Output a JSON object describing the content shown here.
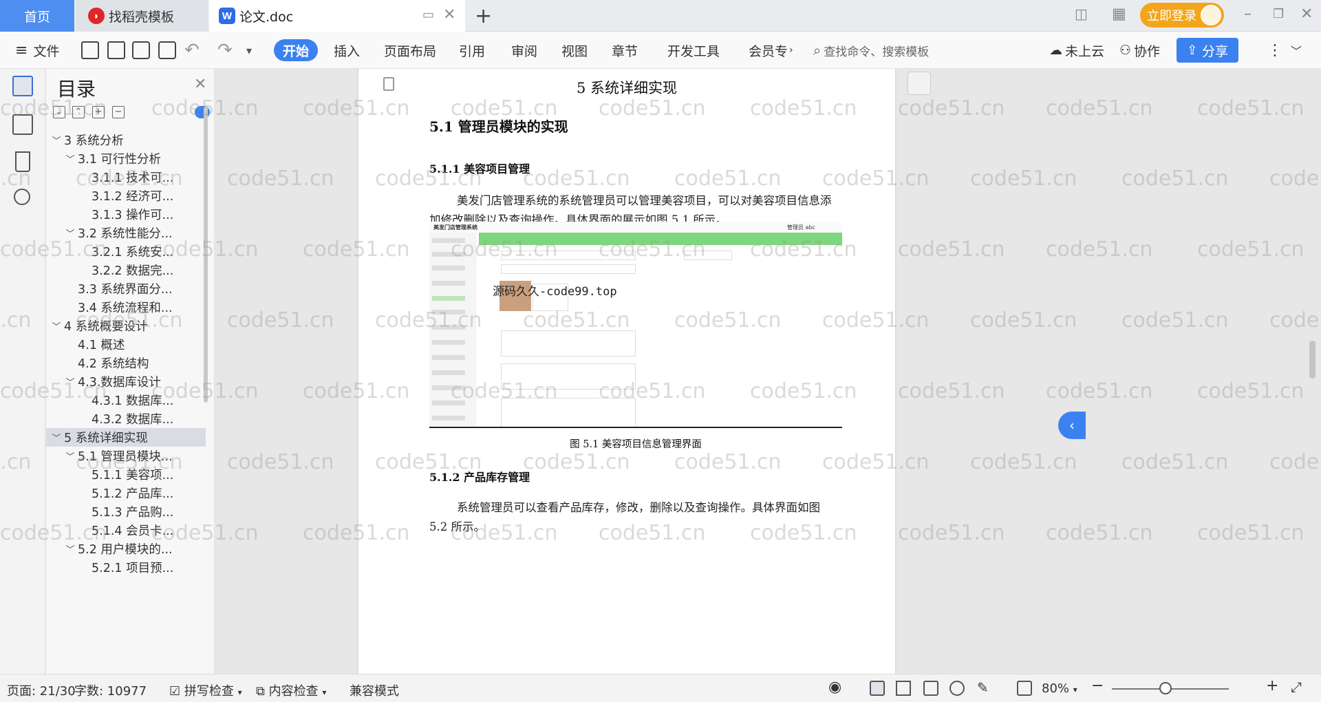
{
  "tabs": {
    "home": "首页",
    "template": "找稻壳模板",
    "doc": "论文.doc"
  },
  "topright": {
    "login": "立即登录"
  },
  "toolbar": {
    "file": "文件",
    "menus": [
      "开始",
      "插入",
      "页面布局",
      "引用",
      "审阅",
      "视图",
      "章节",
      "开发工具",
      "会员专"
    ],
    "search_placeholder": "查找命令、搜索模板",
    "cloud": "未上云",
    "collab": "协作",
    "share": "分享"
  },
  "toc": {
    "title": "目录",
    "items": [
      {
        "level": 1,
        "caret": "﹀",
        "label": "3 系统分析",
        "active": false
      },
      {
        "level": 2,
        "caret": "﹀",
        "label": "3.1 可行性分析",
        "active": false
      },
      {
        "level": 3,
        "caret": "",
        "label": "3.1.1 技术可...",
        "active": false
      },
      {
        "level": 3,
        "caret": "",
        "label": "3.1.2 经济可...",
        "active": false
      },
      {
        "level": 3,
        "caret": "",
        "label": "3.1.3 操作可...",
        "active": false
      },
      {
        "level": 2,
        "caret": "﹀",
        "label": "3.2 系统性能分...",
        "active": false
      },
      {
        "level": 3,
        "caret": "",
        "label": "3.2.1  系统安...",
        "active": false
      },
      {
        "level": 3,
        "caret": "",
        "label": "3.2.2  数据完...",
        "active": false
      },
      {
        "level": 2,
        "caret": "",
        "label": "3.3 系统界面分...",
        "active": false
      },
      {
        "level": 2,
        "caret": "",
        "label": "3.4 系统流程和...",
        "active": false
      },
      {
        "level": 1,
        "caret": "﹀",
        "label": "4 系统概要设计",
        "active": false
      },
      {
        "level": 2,
        "caret": "",
        "label": "4.1 概述",
        "active": false
      },
      {
        "level": 2,
        "caret": "",
        "label": "4.2 系统结构",
        "active": false
      },
      {
        "level": 2,
        "caret": "﹀",
        "label": "4.3.数据库设计",
        "active": false
      },
      {
        "level": 3,
        "caret": "",
        "label": "4.3.1 数据库...",
        "active": false
      },
      {
        "level": 3,
        "caret": "",
        "label": "4.3.2 数据库...",
        "active": false
      },
      {
        "level": 1,
        "caret": "﹀",
        "label": "5 系统详细实现",
        "active": true
      },
      {
        "level": 2,
        "caret": "﹀",
        "label": "5.1  管理员模块...",
        "active": false
      },
      {
        "level": 3,
        "caret": "",
        "label": "5.1.1  美容项...",
        "active": false
      },
      {
        "level": 3,
        "caret": "",
        "label": "5.1.2  产品库...",
        "active": false
      },
      {
        "level": 3,
        "caret": "",
        "label": "5.1.3  产品购...",
        "active": false
      },
      {
        "level": 3,
        "caret": "",
        "label": "5.1.4  会员卡...",
        "active": false
      },
      {
        "level": 2,
        "caret": "﹀",
        "label": "5.2  用户模块的...",
        "active": false
      },
      {
        "level": 3,
        "caret": "",
        "label": "5.2.1  项目预...",
        "active": false
      }
    ]
  },
  "document": {
    "chapter": "5 系统详细实现",
    "section": "5.1  管理员模块的实现",
    "sub1": "5.1.1  美容项目管理",
    "para1": "美发门店管理系统的系统管理员可以管理美容项目，可以对美容项目信息添加修改删除以及查询操作。具体界面的展示如图 5.1 所示。",
    "figure": {
      "app_title": "美发门店管理系统",
      "user": "管理员 abc",
      "watermark": "源码久久-code99.top",
      "caption": "图 5.1  美容项目信息管理界面"
    },
    "sub2": "5.1.2  产品库存管理",
    "para2": "系统管理员可以查看产品库存，修改，删除以及查询操作。具体界面如图 5.2 所示。"
  },
  "watermark": "code51.cn",
  "status": {
    "page": "页面: 21/30",
    "words": "字数: 10977",
    "spell": "拼写检查",
    "content": "内容检查",
    "mode": "兼容模式",
    "zoom": "80%"
  },
  "colors": {
    "accent": "#3b82f0",
    "login": "#f3a51b",
    "figure_bar": "#7ed67e"
  }
}
